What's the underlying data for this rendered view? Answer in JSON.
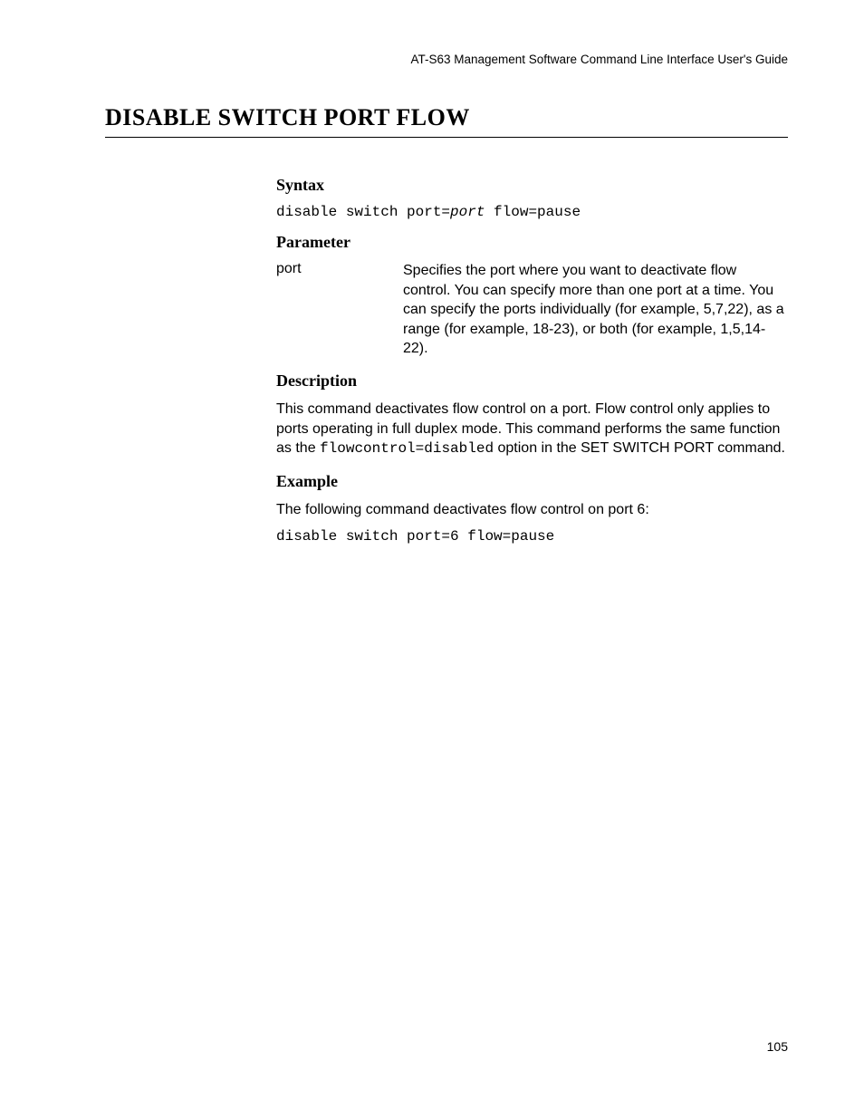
{
  "header": {
    "guide": "AT-S63 Management Software Command Line Interface User's Guide"
  },
  "title": "DISABLE SWITCH PORT FLOW",
  "sections": {
    "syntax": {
      "heading": "Syntax",
      "part1": "disable switch port=",
      "part_var": "port",
      "part3": " flow=pause"
    },
    "parameter": {
      "heading": "Parameter",
      "name": "port",
      "desc": "Specifies the port where you want to deactivate flow control. You can specify more than one port at a time. You can specify the ports individually (for example, 5,7,22), as a range (for example, 18-23), or both (for example, 1,5,14-22)."
    },
    "description": {
      "heading": "Description",
      "pre": "This command deactivates flow control on a port. Flow control only applies to ports operating in full duplex mode. This command performs the same function as the ",
      "code": "flowcontrol=disabled",
      "post": " option in the SET SWITCH PORT command."
    },
    "example": {
      "heading": "Example",
      "intro": "The following command deactivates flow control on port 6:",
      "cmd": "disable switch port=6 flow=pause"
    }
  },
  "page_number": "105"
}
